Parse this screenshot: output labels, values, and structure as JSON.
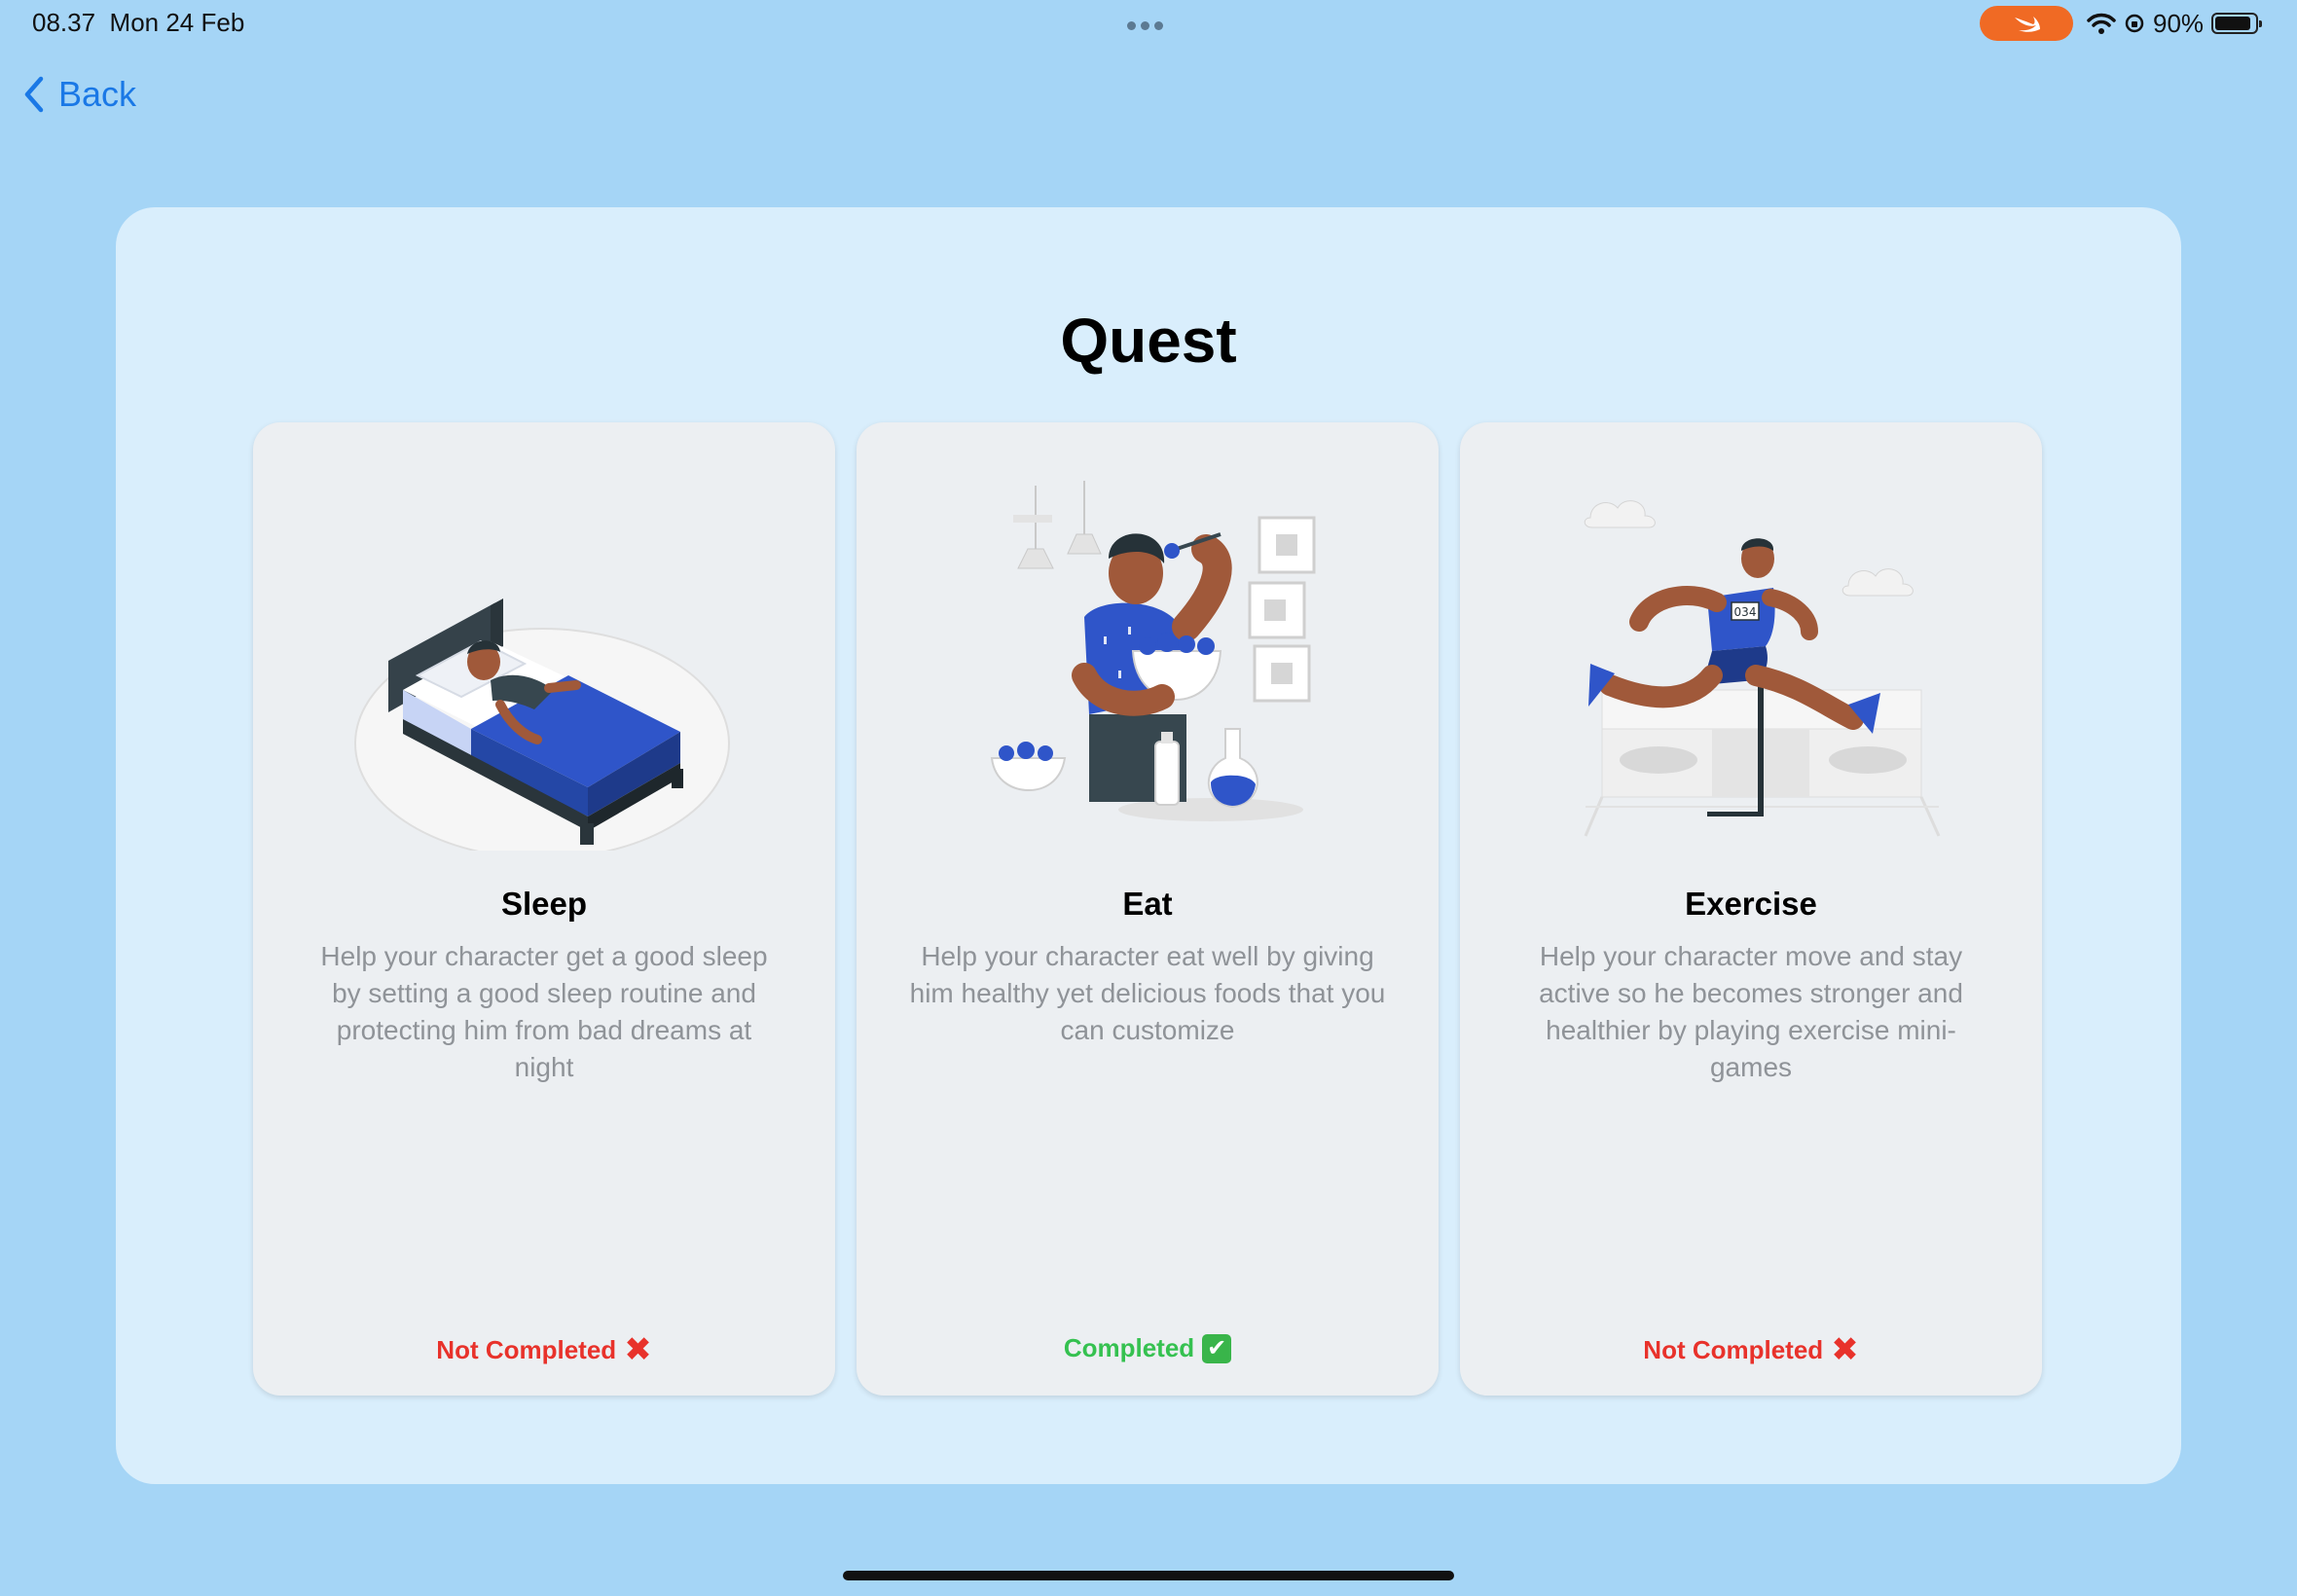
{
  "status_bar": {
    "time": "08.37",
    "date": "Mon 24 Feb",
    "battery": "90%",
    "battery_level": 0.9
  },
  "nav": {
    "back_label": "Back"
  },
  "page": {
    "title": "Quest"
  },
  "cards": [
    {
      "title": "Sleep",
      "description": "Help your character get a good sleep by setting a good sleep routine and protecting him from bad dreams at night",
      "status": "Not Completed",
      "status_icon": "cross-mark-icon",
      "illustration": "sleeping-in-bed-illustration"
    },
    {
      "title": "Eat",
      "description": "Help your character eat well by giving him healthy yet delicious foods that you can customize",
      "status": "Completed",
      "status_icon": "check-mark-icon",
      "illustration": "eating-salad-illustration"
    },
    {
      "title": "Exercise",
      "description": "Help your character move and stay active so he becomes stronger and healthier by playing exercise mini-games",
      "status": "Not Completed",
      "status_icon": "cross-mark-icon",
      "illustration": "hurdle-running-illustration",
      "bib_number": "034"
    }
  ],
  "colors": {
    "background": "#a5d5f6",
    "panel": "#d9eefc",
    "card": "#eceff2",
    "accent_blue": "#1a78e6",
    "illustration_blue": "#2f55c9",
    "not_completed": "#e8322b",
    "completed": "#35c150"
  }
}
